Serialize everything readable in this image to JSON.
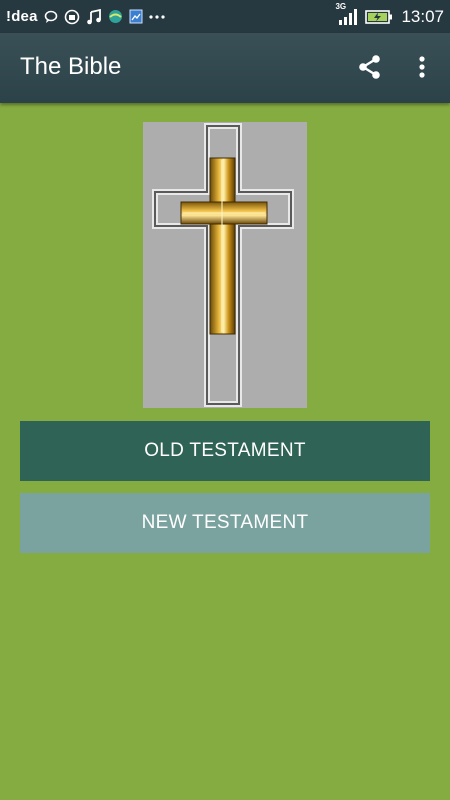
{
  "status_bar": {
    "carrier": "!dea",
    "network": "3G",
    "time": "13:07",
    "icons": [
      "chat-bubble-icon",
      "android-debug-icon",
      "music-note-icon",
      "app-ball-icon",
      "gallery-icon",
      "more-notifications-icon",
      "signal-icon",
      "battery-charging-icon"
    ]
  },
  "app_bar": {
    "title": "The Bible",
    "actions": [
      "share-icon",
      "overflow-menu-icon"
    ]
  },
  "main": {
    "image": "golden-cross-icon",
    "buttons": [
      {
        "label": "OLD TESTAMENT",
        "color": "#2f6355"
      },
      {
        "label": "NEW TESTAMENT",
        "color": "#7aa3a0"
      }
    ]
  },
  "colors": {
    "background": "#85ac40",
    "app_bar": "#33484f",
    "status_bar": "#263840",
    "image_panel": "#aeadae"
  }
}
